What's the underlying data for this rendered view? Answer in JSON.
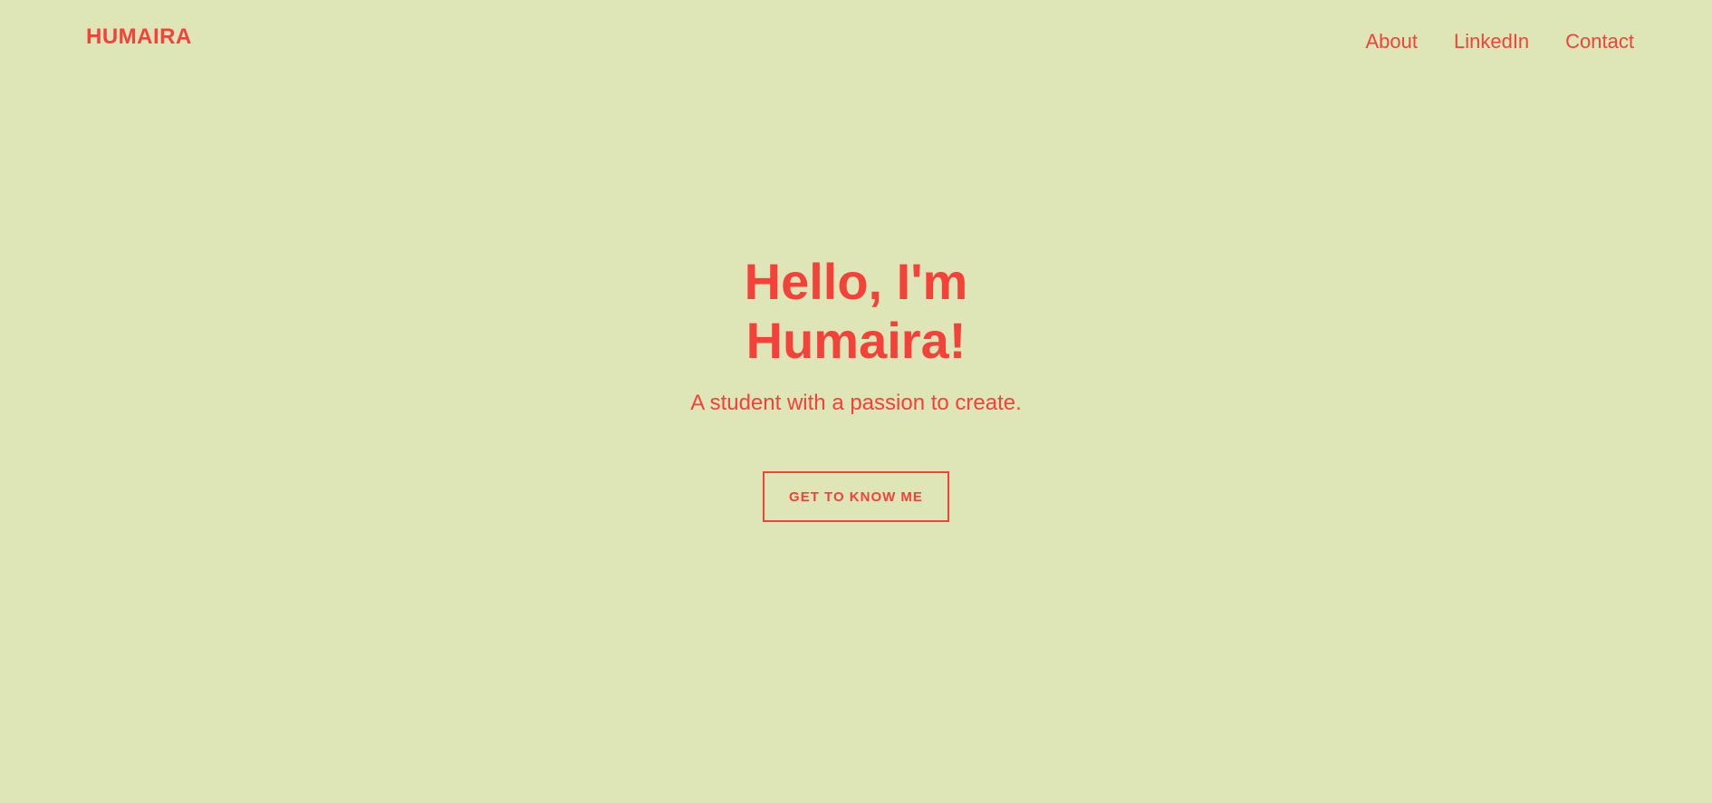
{
  "header": {
    "logo": "HUMAIRA",
    "nav": [
      {
        "label": "About"
      },
      {
        "label": "LinkedIn"
      },
      {
        "label": "Contact"
      }
    ]
  },
  "hero": {
    "title_line1": "Hello, I'm",
    "title_line2": "Humaira!",
    "subtitle": "A student with a passion to create.",
    "cta_label": "GET TO KNOW ME"
  },
  "colors": {
    "background": "#dee5b6",
    "accent": "#f4413a"
  }
}
